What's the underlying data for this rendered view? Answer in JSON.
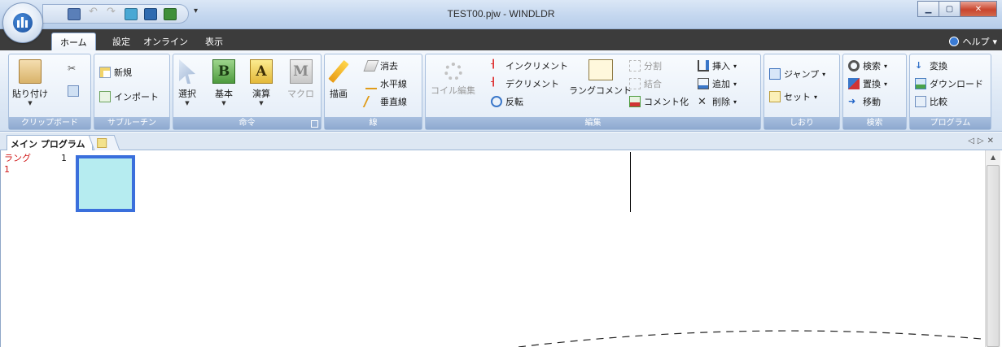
{
  "window": {
    "title": "TEST00.pjw - WINDLDR",
    "qat_more": "▾"
  },
  "tabs": {
    "home": "ホーム",
    "settings": "設定",
    "online": "オンライン",
    "view": "表示",
    "help": "ヘルプ"
  },
  "ribbon": {
    "clipboard": {
      "label": "クリップボード",
      "paste": "貼り付け"
    },
    "subroutine": {
      "label": "サブルーチン",
      "new": "新規",
      "import": "インポート"
    },
    "command": {
      "label": "命令",
      "select": "選択",
      "basic": "基本",
      "calc": "演算",
      "macro": "マクロ",
      "basic_letter": "B",
      "calc_letter": "A",
      "macro_letter": "M"
    },
    "line": {
      "label": "線",
      "draw": "描画",
      "erase": "消去",
      "hline": "水平線",
      "vline": "垂直線"
    },
    "edit": {
      "label": "編集",
      "coil_edit": "コイル編集",
      "increment": "インクリメント",
      "decrement": "デクリメント",
      "invert": "反転",
      "rung_comment": "ラングコメント",
      "split": "分割",
      "merge": "結合",
      "comment_out": "コメント化",
      "insert": "挿入",
      "add": "追加",
      "delete": "削除"
    },
    "bookmark": {
      "label": "しおり",
      "jump": "ジャンプ",
      "set": "セット"
    },
    "search": {
      "label": "検索",
      "find": "検索",
      "replace": "置換",
      "move": "移動"
    },
    "program": {
      "label": "プログラム",
      "convert": "変換",
      "download": "ダウンロード",
      "compare": "比較"
    }
  },
  "doc": {
    "tab": "メイン プログラム",
    "nav": "◁▷✕"
  },
  "editor": {
    "rung_label": "ラング",
    "rung_index": "1",
    "rung_number": "1"
  }
}
